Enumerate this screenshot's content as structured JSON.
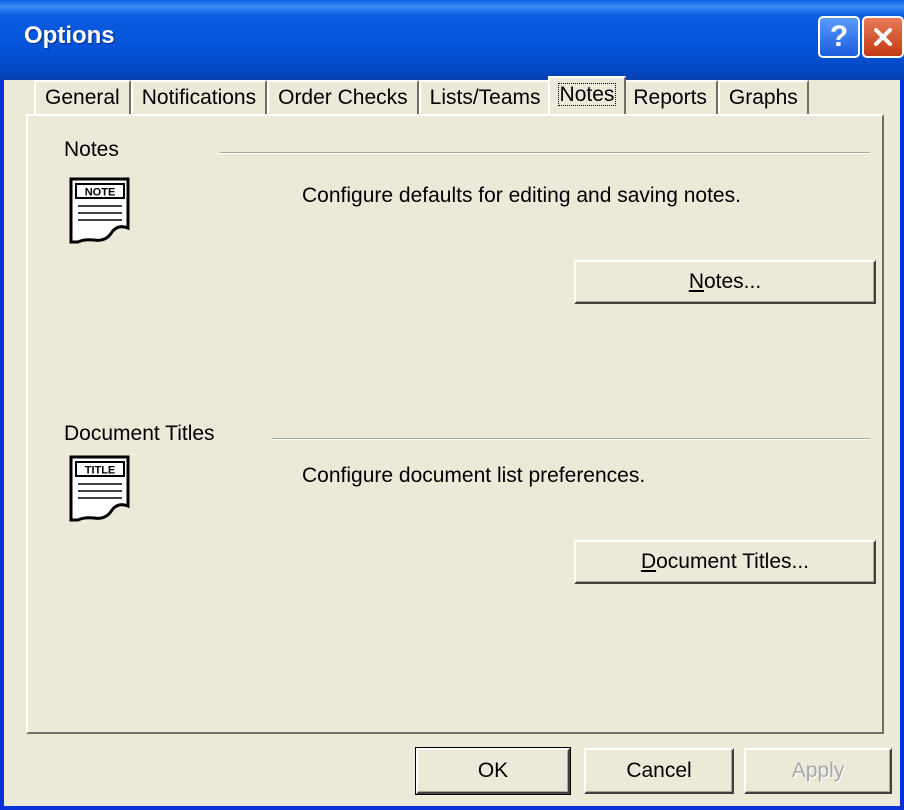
{
  "window": {
    "title": "Options"
  },
  "titlebar": {
    "help_label": "?"
  },
  "tabs": [
    {
      "label": "General"
    },
    {
      "label": "Notifications"
    },
    {
      "label": "Order Checks"
    },
    {
      "label": "Lists/Teams"
    },
    {
      "label": "Notes",
      "selected": true
    },
    {
      "label": "Reports"
    },
    {
      "label": "Graphs"
    }
  ],
  "notes_section": {
    "heading": "Notes",
    "icon_label": "NOTE",
    "icon": "note-document-icon",
    "description": "Configure defaults for editing and saving notes.",
    "button": {
      "mnemonic": "N",
      "rest": "otes..."
    }
  },
  "titles_section": {
    "heading": "Document Titles",
    "icon_label": "TITLE",
    "icon": "title-document-icon",
    "description": "Configure document list preferences.",
    "button": {
      "mnemonic": "D",
      "rest": "ocument Titles..."
    }
  },
  "footer": {
    "ok": "OK",
    "cancel": "Cancel",
    "apply": "Apply"
  },
  "colors": {
    "titlebar": "#0553d8",
    "frame": "#0831d9",
    "face": "#ece9d8",
    "close": "#c33a12"
  }
}
